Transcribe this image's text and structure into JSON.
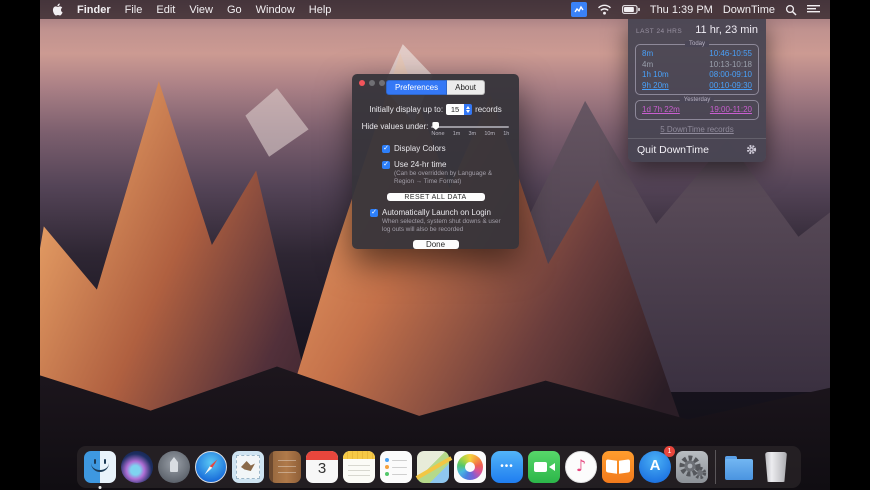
{
  "colors": {
    "accent": "#3478f6",
    "row_blue": "#49a0f8",
    "row_gray": "#9aa0ac",
    "row_magenta": "#c95fd0"
  },
  "icons": {
    "menu_bar": [
      "apple-icon",
      "downtime-status-icon",
      "wifi-icon",
      "battery-icon",
      "search-icon",
      "notification-center-icon"
    ],
    "panel": [
      "gear-icon"
    ],
    "dock": [
      "finder",
      "siri",
      "launchpad",
      "safari",
      "mail",
      "contacts",
      "calendar",
      "notes",
      "reminders",
      "maps",
      "photos",
      "messages",
      "facetime",
      "itunes",
      "ibooks",
      "app-store",
      "system-preferences",
      "downloads",
      "trash"
    ]
  },
  "menu_bar": {
    "items": [
      "Finder",
      "File",
      "Edit",
      "View",
      "Go",
      "Window",
      "Help"
    ],
    "time": "Thu 1:39 PM",
    "app_title": "DownTime"
  },
  "downtime_panel": {
    "header_label": "LAST 24 HRS",
    "total": "11 hr, 23 min",
    "today": {
      "title": "Today",
      "rows": [
        {
          "duration": "8m",
          "range": "10:46-10:55"
        },
        {
          "duration": "4m",
          "range": "10:13-10:18"
        },
        {
          "duration": "1h 10m",
          "range": "08:00-09:10"
        },
        {
          "duration": "9h 20m",
          "range": "00:10-09:30"
        }
      ]
    },
    "yesterday": {
      "title": "Yesterday",
      "rows": [
        {
          "duration": "1d 7h 22m",
          "range": "19:00-11:20"
        }
      ]
    },
    "records_link": "5 DownTime records",
    "quit_label": "Quit DownTime"
  },
  "preferences_window": {
    "tabs": [
      {
        "label": "Preferences"
      },
      {
        "label": "About"
      }
    ],
    "display_row": {
      "label": "Initially display up to:",
      "value": "15",
      "suffix": "records"
    },
    "hide_row": {
      "label": "Hide values under:",
      "ticks": [
        "None",
        "1m",
        "3m",
        "10m",
        "1h"
      ]
    },
    "display_colors_label": "Display Colors",
    "use_24hr_label": "Use 24-hr time",
    "use_24hr_note": "(Can be overridden by Language & Region → Time Format)",
    "reset_button": "RESET ALL DATA",
    "launch_label": "Automatically Launch on Login",
    "launch_note": "When selected, system shut downs & user log outs will also be recorded",
    "done_button": "Done"
  },
  "dock": {
    "calendar_day": "3",
    "appstore_letter": "A",
    "appstore_badge": "1"
  }
}
